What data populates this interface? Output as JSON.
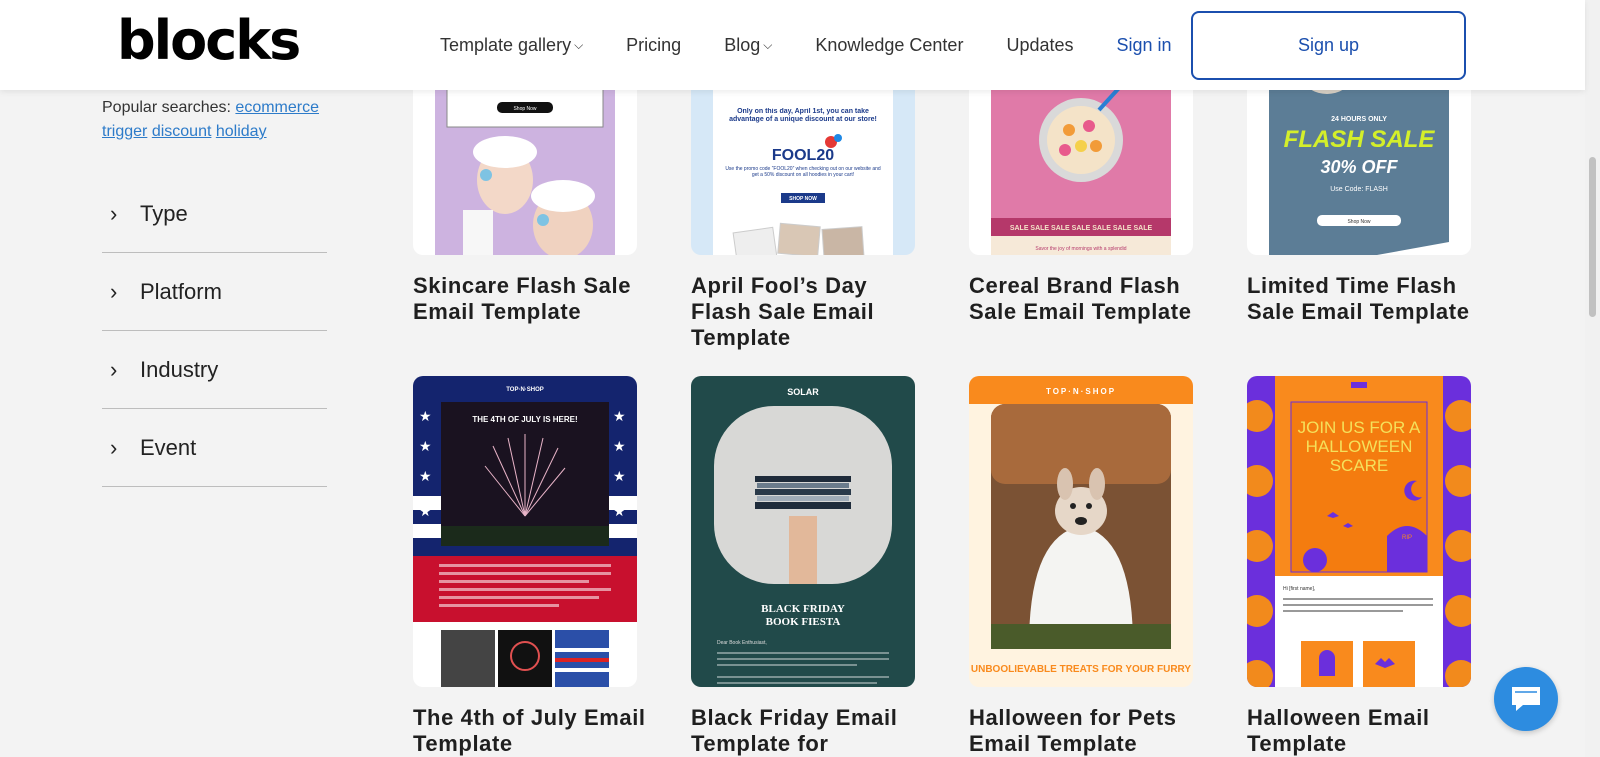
{
  "header": {
    "logo": "blocks",
    "nav": [
      {
        "label": "Template gallery",
        "has_dropdown": true
      },
      {
        "label": "Pricing",
        "has_dropdown": false
      },
      {
        "label": "Blog",
        "has_dropdown": true
      },
      {
        "label": "Knowledge Center",
        "has_dropdown": false
      },
      {
        "label": "Updates",
        "has_dropdown": false
      }
    ],
    "signin_label": "Sign in",
    "signup_label": "Sign up",
    "dropdown_icon": "chevron-down-icon"
  },
  "sidebar": {
    "popular_label": "Popular searches:",
    "popular_links": [
      "ecommerce",
      "trigger",
      "discount",
      "holiday"
    ],
    "filters": [
      {
        "label": "Type",
        "icon": "chevron-right-icon"
      },
      {
        "label": "Platform",
        "icon": "chevron-right-icon"
      },
      {
        "label": "Industry",
        "icon": "chevron-right-icon"
      },
      {
        "label": "Event",
        "icon": "chevron-right-icon"
      }
    ]
  },
  "cards": [
    {
      "title": "Skincare Flash Sale Email Template",
      "thumb_texts": {
        "button": "Shop Now"
      }
    },
    {
      "title": "April Fool’s Day Flash Sale Email Template",
      "thumb_texts": {
        "headline": "Only on this day, April 1st, you can take advantage of a unique discount at our store!",
        "code": "FOOL20",
        "body": "Use the promo code “FOOL20” when checking out on our website and get a 50% discount on all hoodies in your cart!",
        "button": "SHOP NOW"
      }
    },
    {
      "title": "Cereal Brand Flash Sale Email Template",
      "thumb_texts": {
        "banner": "SALE SALE SALE SALE SALE SALE SALE",
        "footer": "Savor the joy of mornings with a splendid"
      }
    },
    {
      "title": "Limited Time Flash Sale Email Template",
      "thumb_texts": {
        "kicker": "24 HOURS ONLY",
        "headline": "FLASH SALE",
        "discount": "30% OFF",
        "code": "Use Code: FLASH",
        "button": "Shop Now"
      }
    },
    {
      "title": "The 4th of July Email Template",
      "thumb_texts": {
        "brand": "TOP·N·SHOP",
        "headline": "THE 4TH OF JULY IS HERE!"
      }
    },
    {
      "title": "Black Friday Email Template for",
      "thumb_texts": {
        "brand": "SOLAR",
        "headline": "BLACK FRIDAY BOOK FIESTA",
        "greeting": "Dear Book Enthusiast,"
      }
    },
    {
      "title": "Halloween for Pets Email Template",
      "thumb_texts": {
        "brand": "TOP·N·SHOP",
        "headline": "UNBOOLIEVABLE TREATS FOR YOUR FURRY"
      }
    },
    {
      "title": "Halloween Email Template",
      "thumb_texts": {
        "headline": "JOIN US FOR A HALLOWEEN SCARE",
        "greeting": "Hi [first name],",
        "rip": "RIP"
      }
    }
  ],
  "chat": {
    "icon": "chat-icon"
  },
  "colors": {
    "accent": "#1b4fae",
    "link": "#2d7bc9",
    "chat": "#2d8ce0"
  }
}
